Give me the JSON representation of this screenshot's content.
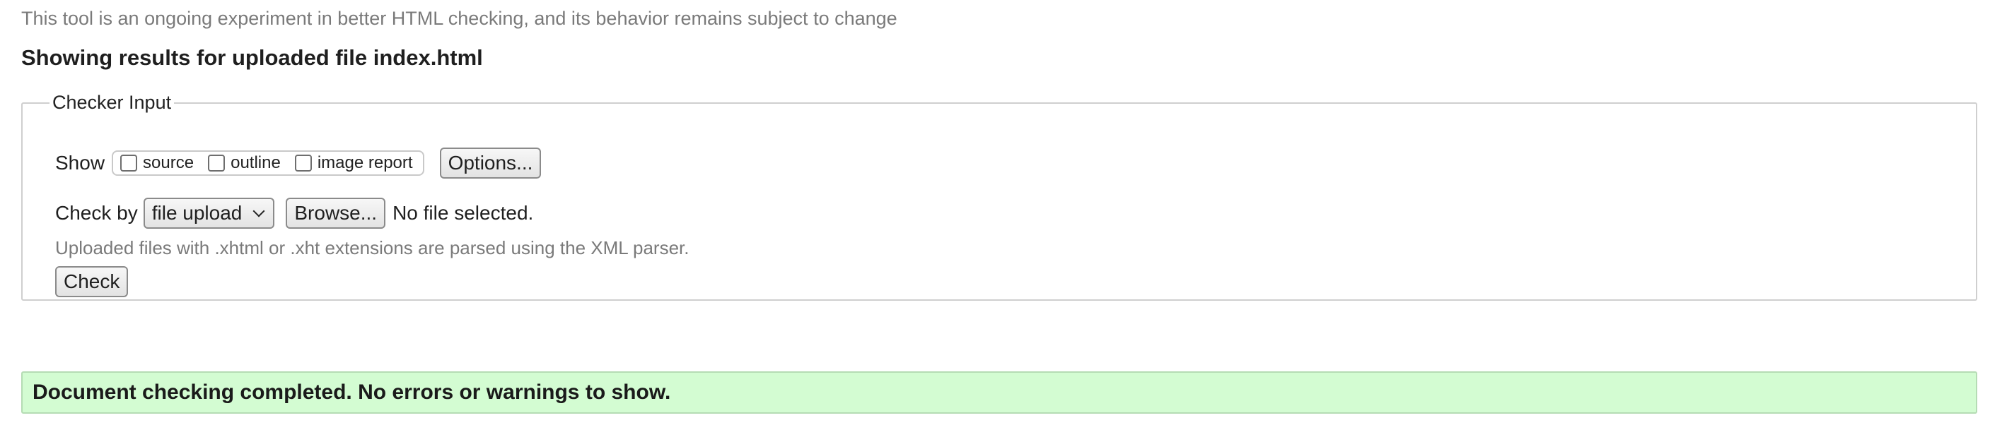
{
  "notice": "This tool is an ongoing experiment in better HTML checking, and its behavior remains subject to change",
  "results_title": "Showing results for uploaded file index.html",
  "checker": {
    "legend": "Checker Input",
    "show_label": "Show",
    "show_options": [
      {
        "label": "source",
        "checked": false
      },
      {
        "label": "outline",
        "checked": false
      },
      {
        "label": "image report",
        "checked": false
      }
    ],
    "options_button": "Options...",
    "check_by_label": "Check by",
    "check_by_selected": "file upload",
    "browse_button": "Browse...",
    "file_status": "No file selected.",
    "hint": "Uploaded files with .xhtml or .xht extensions are parsed using the XML parser.",
    "check_button": "Check"
  },
  "result_message": "Document checking completed. No errors or warnings to show.",
  "colors": {
    "success_bg": "#d3fcd2",
    "success_border": "#b5dcb4",
    "muted_text": "#7a7a7a"
  }
}
